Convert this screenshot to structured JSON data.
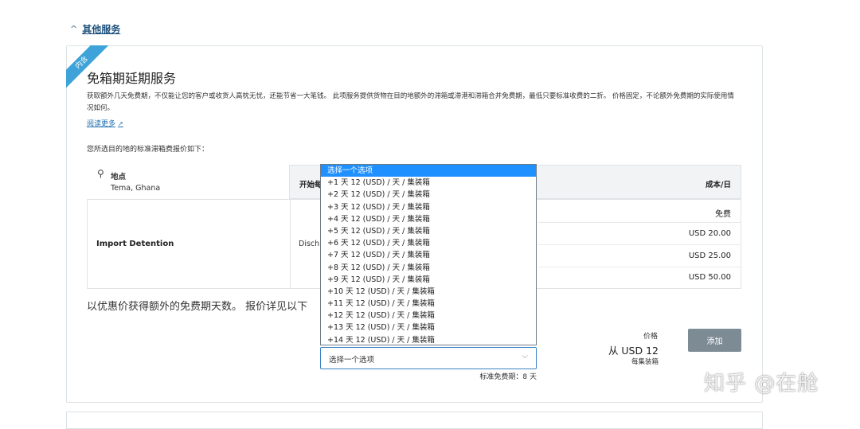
{
  "section": {
    "title": "其他服务",
    "chevron": "^"
  },
  "service": {
    "badge": "内含",
    "title": "免箱期延期服务",
    "description": "获取额外几天免费期，不仅能让您的客户或收货人高枕无忧，还能节省一大笔钱。 此项服务提供货物在目的地额外的滞箱或滞港和滞箱合并免费期，最低只要标准收费的二折。 价格固定，不论额外免费期的实际使用情况如何。",
    "read_more": "阅读更多",
    "std_label": "您所选目的地的标准滞箱费报价如下："
  },
  "location": {
    "label": "地点",
    "value": "Tema, Ghana",
    "icon": "location-pin-icon"
  },
  "table": {
    "col_start": "开始每",
    "col_cost": "成本/日",
    "type": "Import Detention",
    "start_value": "Disch",
    "costs": [
      "免费",
      "USD 20.00",
      "USD 25.00",
      "USD 50.00"
    ]
  },
  "promo": "以优惠价获得额外的免费期天数。 报价详见以下",
  "price": {
    "label": "价格",
    "value": "从 USD 12",
    "unit": "每集装箱"
  },
  "add_button": "添加",
  "select": {
    "value": "选择一个选项",
    "free_note": "标准免费期：8 天"
  },
  "dropdown": {
    "options": [
      "选择一个选项",
      "+1 天 12 (USD) / 天 / 集装箱",
      "+2 天 12 (USD) / 天 / 集装箱",
      "+3 天 12 (USD) / 天 / 集装箱",
      "+4 天 12 (USD) / 天 / 集装箱",
      "+5 天 12 (USD) / 天 / 集装箱",
      "+6 天 12 (USD) / 天 / 集装箱",
      "+7 天 12 (USD) / 天 / 集装箱",
      "+8 天 12 (USD) / 天 / 集装箱",
      "+9 天 12 (USD) / 天 / 集装箱",
      "+10 天 12 (USD) / 天 / 集装箱",
      "+11 天 12 (USD) / 天 / 集装箱",
      "+12 天 12 (USD) / 天 / 集装箱",
      "+13 天 12 (USD) / 天 / 集装箱",
      "+14 天 12 (USD) / 天 / 集装箱"
    ]
  },
  "watermark": "知乎 @在舱"
}
